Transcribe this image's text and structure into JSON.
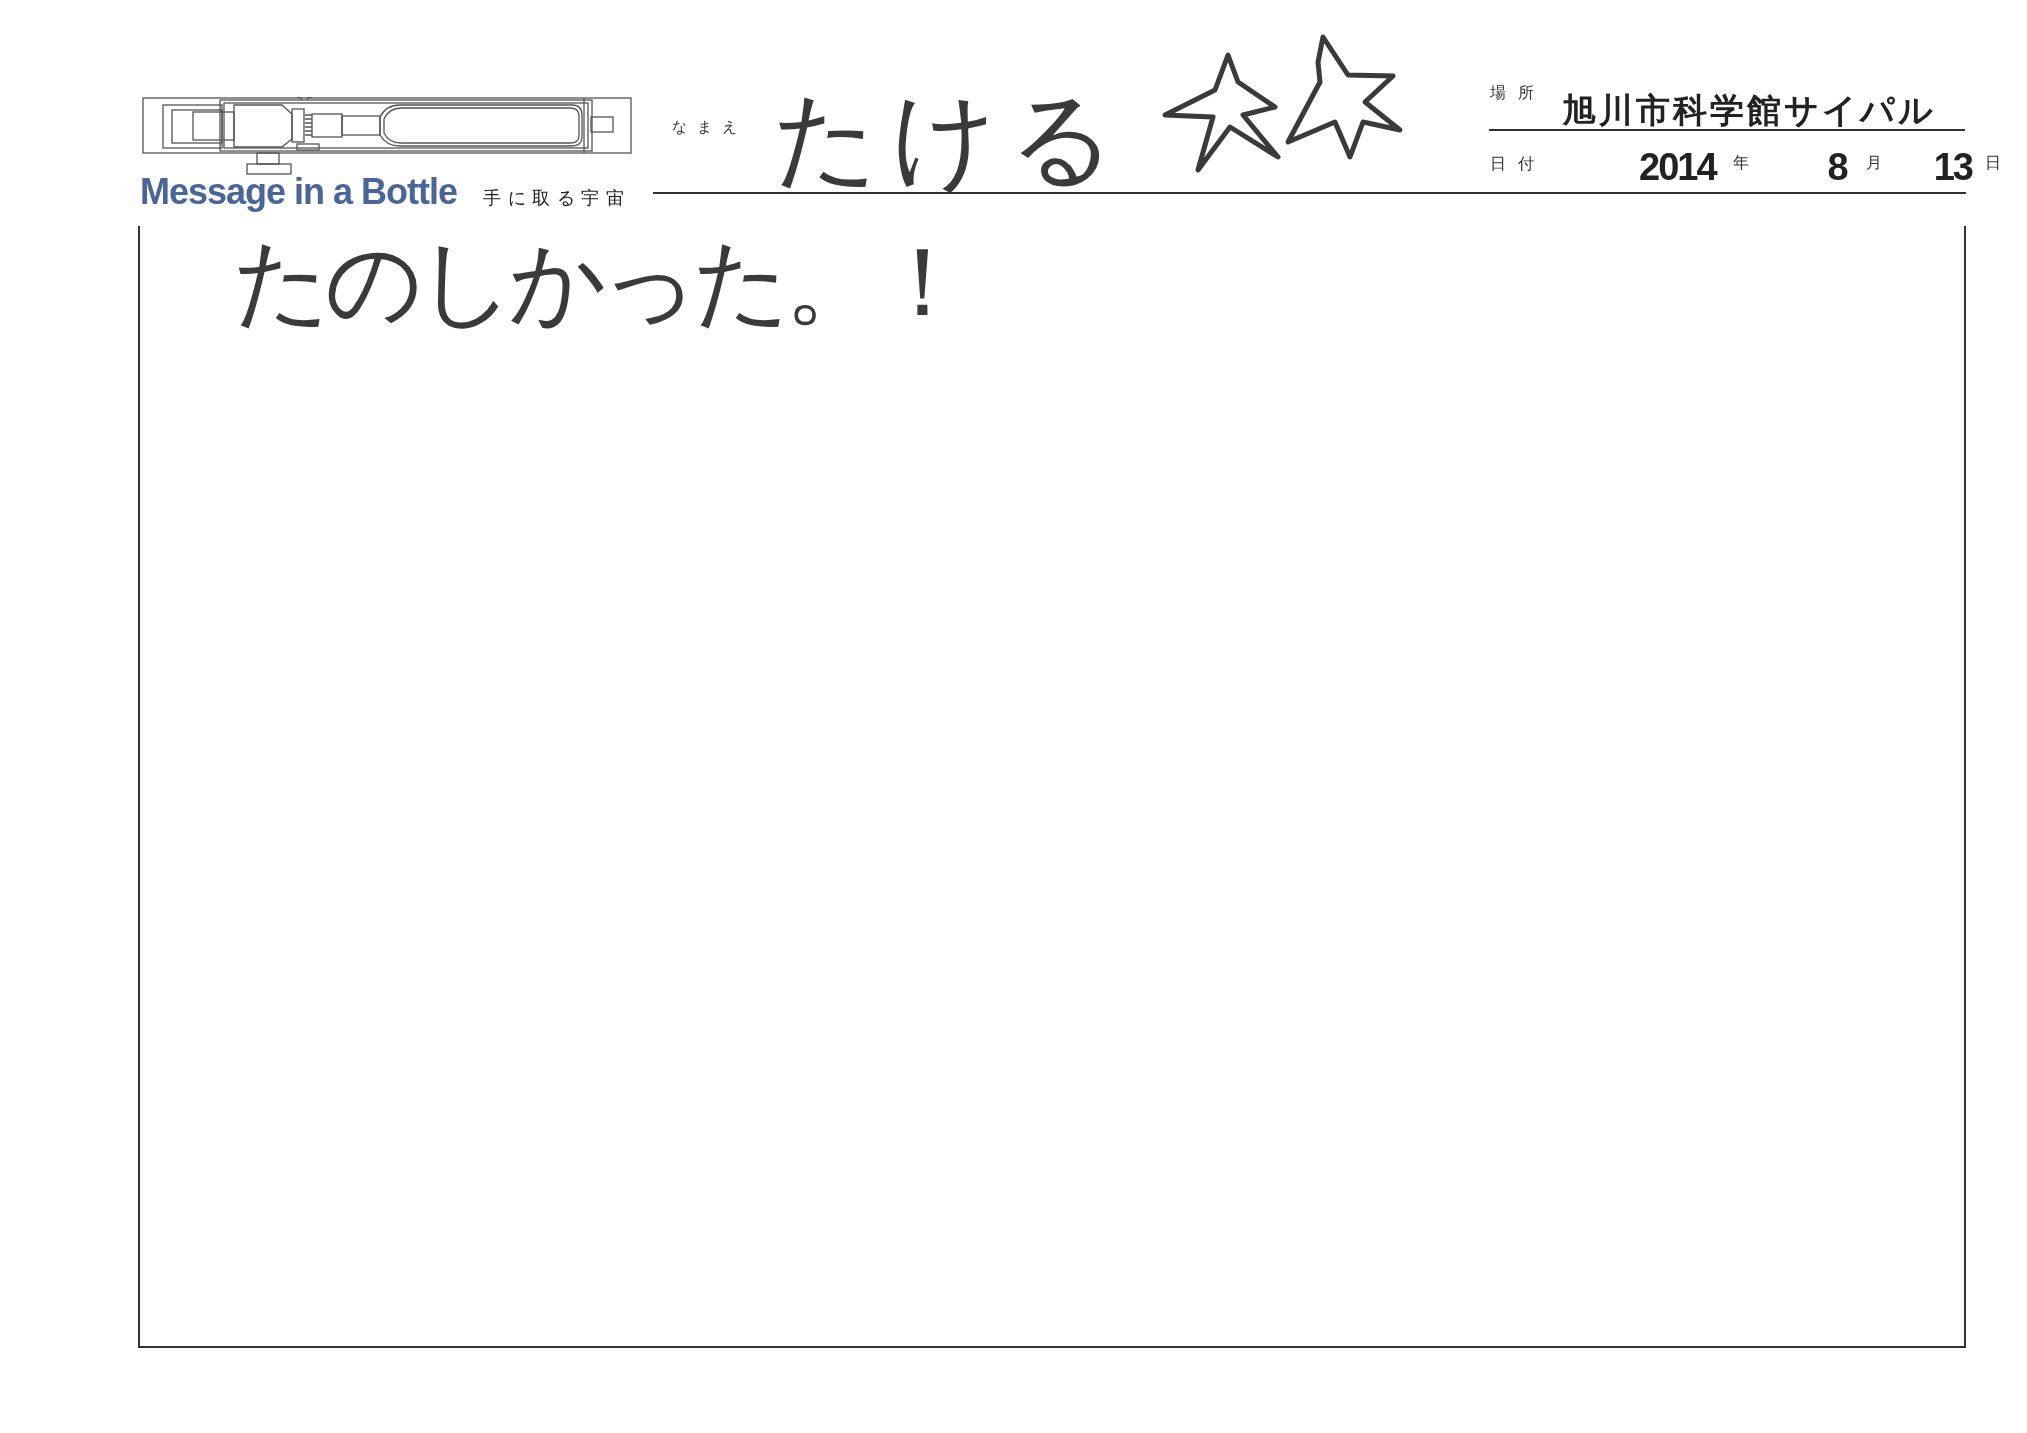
{
  "header": {
    "logo": {
      "title": "Message in a Bottle",
      "subtitle": "手に取る宇宙"
    },
    "name": {
      "label": "なまえ",
      "value": "たける"
    },
    "place": {
      "label": "場所",
      "value": "旭川市科学館サイパル"
    },
    "date": {
      "label": "日付",
      "year": "2014",
      "year_unit": "年",
      "month": "8",
      "month_unit": "月",
      "day": "13",
      "day_unit": "日"
    }
  },
  "message": {
    "value": "たのしかった。！"
  }
}
